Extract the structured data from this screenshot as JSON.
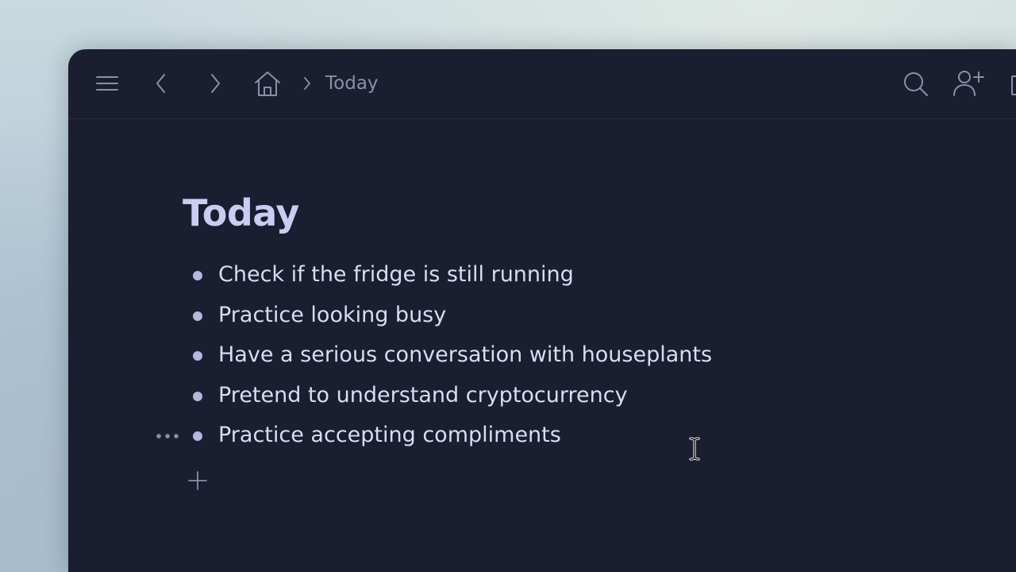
{
  "toolbar": {
    "menu_icon": "hamburger-menu-icon",
    "back_icon": "chevron-left-icon",
    "forward_icon": "chevron-right-icon",
    "home_icon": "home-icon",
    "breadcrumb": [
      "Today"
    ],
    "search_icon": "search-icon",
    "add_user_icon": "add-user-icon"
  },
  "page": {
    "title": "Today",
    "items": [
      {
        "text": "Check if the fridge is still running"
      },
      {
        "text": "Practice looking busy"
      },
      {
        "text": "Have a serious conversation with houseplants"
      },
      {
        "text": "Pretend to understand cryptocurrency"
      },
      {
        "text": "Practice accepting compliments"
      }
    ]
  },
  "colors": {
    "window_bg": "#1b1d30",
    "title": "#c9cdf1",
    "text": "#d9dcf2",
    "icon": "#8c8fa6"
  }
}
